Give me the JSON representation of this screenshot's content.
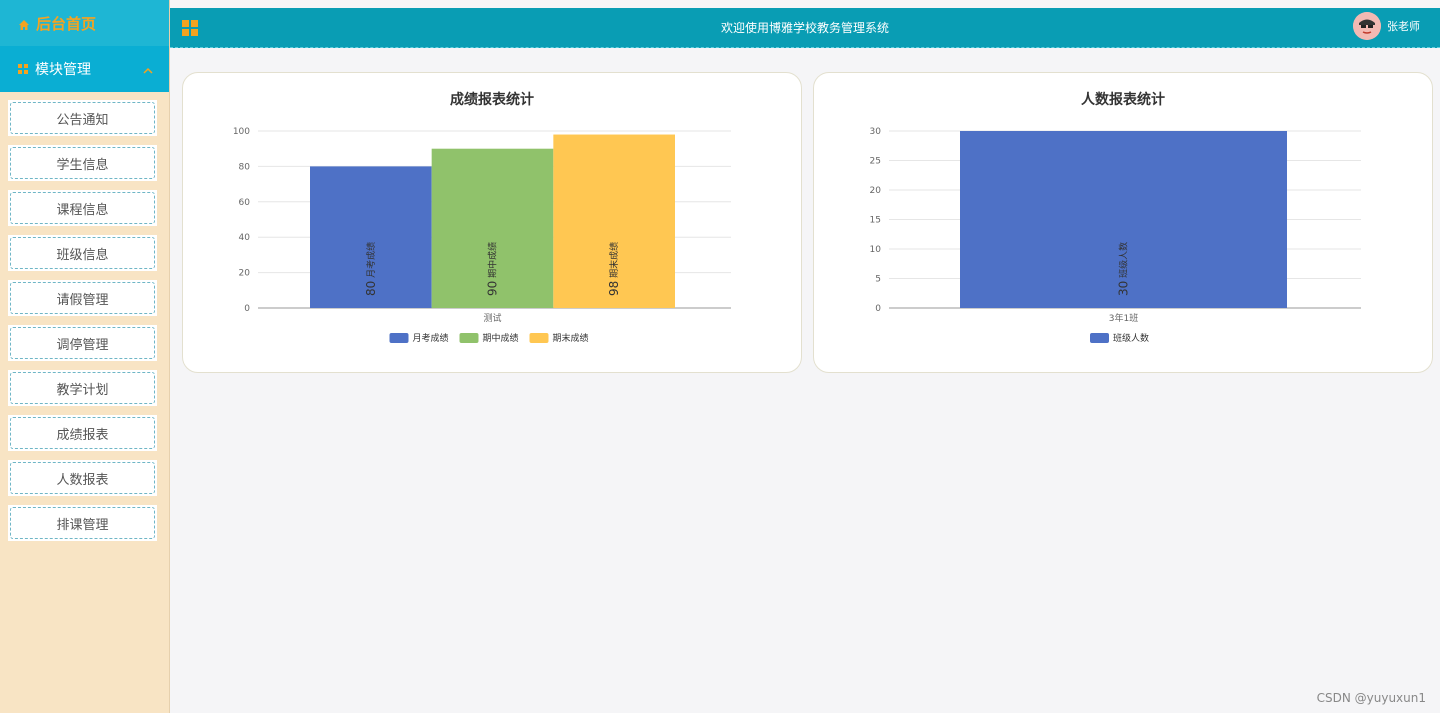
{
  "sidebar": {
    "home_label": "后台首页",
    "module_label": "模块管理",
    "items": [
      {
        "label": "公告通知"
      },
      {
        "label": "学生信息"
      },
      {
        "label": "课程信息"
      },
      {
        "label": "班级信息"
      },
      {
        "label": "请假管理"
      },
      {
        "label": "调停管理"
      },
      {
        "label": "教学计划"
      },
      {
        "label": "成绩报表"
      },
      {
        "label": "人数报表"
      },
      {
        "label": "排课管理"
      }
    ]
  },
  "header": {
    "title": "欢迎使用博雅学校教务管理系统",
    "user_name": "张老师"
  },
  "footer": "CSDN @yuyuxun1",
  "colors": {
    "blue": "#4e71c6",
    "green": "#90c26b",
    "yellow": "#ffc752"
  },
  "chart_data": [
    {
      "type": "bar",
      "title": "成绩报表统计",
      "categories": [
        "测试"
      ],
      "ylim": [
        0,
        100
      ],
      "yticks": [
        0,
        20,
        40,
        60,
        80,
        100
      ],
      "legend_position": "bottom",
      "series": [
        {
          "name": "月考成绩",
          "values": [
            80
          ],
          "color": "#4e71c6"
        },
        {
          "name": "期中成绩",
          "values": [
            90
          ],
          "color": "#90c26b"
        },
        {
          "name": "期末成绩",
          "values": [
            98
          ],
          "color": "#ffc752"
        }
      ]
    },
    {
      "type": "bar",
      "title": "人数报表统计",
      "categories": [
        "3年1班"
      ],
      "ylim": [
        0,
        30
      ],
      "yticks": [
        0,
        5,
        10,
        15,
        20,
        25,
        30
      ],
      "legend_position": "bottom",
      "series": [
        {
          "name": "班级人数",
          "values": [
            30
          ],
          "color": "#4e71c6"
        }
      ]
    }
  ]
}
